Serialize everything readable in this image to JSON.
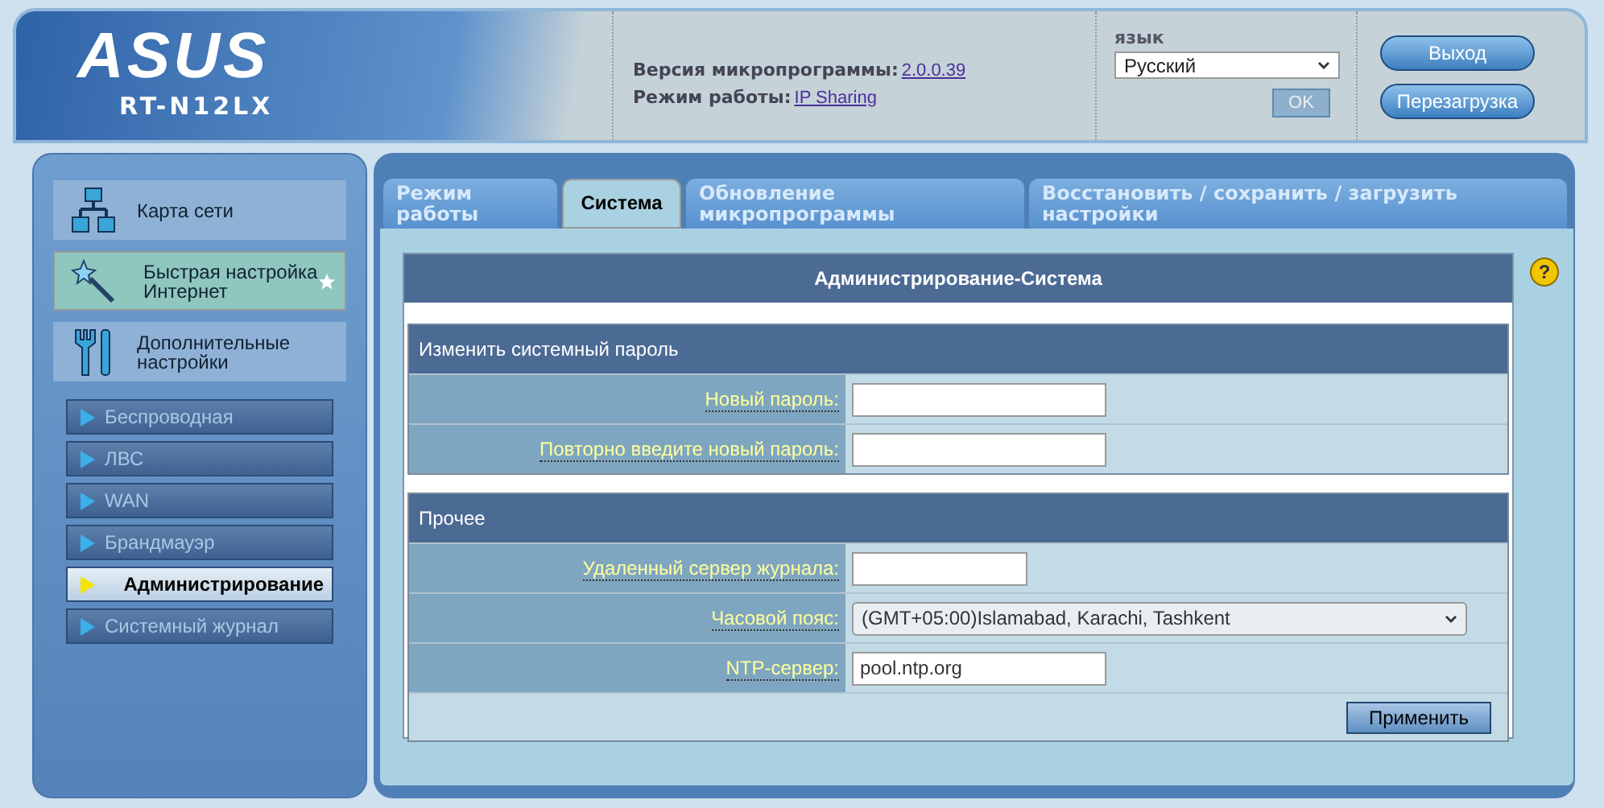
{
  "header": {
    "logo": "ASUS",
    "model": "RT-N12LX",
    "firmware_label": "Версия микропрограммы:",
    "firmware_value": "2.0.0.39",
    "mode_label": "Режим работы:",
    "mode_value": "IP Sharing",
    "language_label": "язык",
    "language_value": "Русский",
    "ok_button": {
      "label": "OK",
      "disabled": true
    },
    "buttons": [
      "Выход",
      "Перезагрузка"
    ]
  },
  "sidebar": {
    "main_items": [
      {
        "kind": "network",
        "label": "Карта сети",
        "selected": false
      },
      {
        "kind": "wizard",
        "label": "Быстрая настройка Интернет",
        "selected": true
      },
      {
        "kind": "tools",
        "label": "Дополнительные настройки",
        "selected": false
      }
    ],
    "sub_items": [
      {
        "label": "Беспроводная",
        "selected": false
      },
      {
        "label": "ЛВС",
        "selected": false
      },
      {
        "label": "WAN",
        "selected": false
      },
      {
        "label": "Брандмауэр",
        "selected": false
      },
      {
        "label": "Администрирование",
        "selected": true
      },
      {
        "label": "Системный журнал",
        "selected": false
      }
    ]
  },
  "tabs": [
    {
      "label": "Режим работы",
      "selected": false
    },
    {
      "label": "Система",
      "selected": true
    },
    {
      "label": "Обновление микропрограммы",
      "selected": false
    },
    {
      "label": "Восстановить / сохранить / загрузить настройки",
      "selected": false
    }
  ],
  "panel": {
    "title": "Администрирование-Система",
    "sections": [
      {
        "title": "Изменить системный пароль",
        "rows": [
          {
            "kind": "text",
            "label": "Новый пароль:"
          },
          {
            "kind": "text",
            "label": "Повторно введите новый пароль:"
          }
        ]
      },
      {
        "title": "Прочее",
        "rows": [
          {
            "kind": "short_text",
            "label": "Удаленный сервер журнала:"
          },
          {
            "kind": "select",
            "label": "Часовой пояс:",
            "value": "(GMT+05:00)Islamabad, Karachi, Tashkent"
          },
          {
            "kind": "text",
            "label": "NTP-сервер:",
            "value": "pool.ntp.org"
          }
        ]
      }
    ],
    "help_icon": "?",
    "apply_button": "Применить"
  }
}
